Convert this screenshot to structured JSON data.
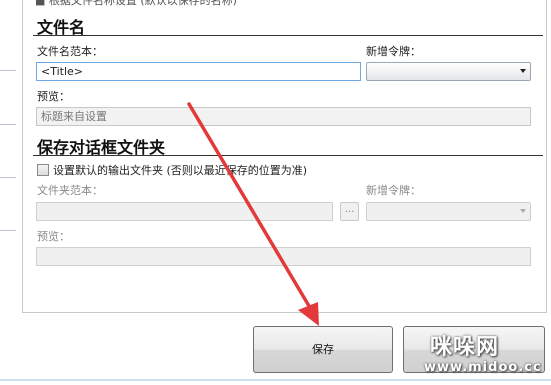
{
  "clipped_top_text": "■ 根据文件名称设置 (默认以保存的名称)",
  "filename_section": {
    "title": "文件名",
    "template_label": "文件名范本：",
    "template_value": "<Title>",
    "token_label": "新增令牌：",
    "preview_label": "预览：",
    "preview_value": "标题来自设置"
  },
  "save_dialog_section": {
    "title": "保存对话框文件夹",
    "checkbox_label": "设置默认的输出文件夹 (否则以最近保存的位置为准)",
    "folder_template_label": "文件夹范本：",
    "browse_label": "...",
    "token_label": "新增令牌：",
    "preview_label": "预览："
  },
  "buttons": {
    "save_label": "保存"
  },
  "watermark": {
    "line1": "咪哚网",
    "line2": "www.midoo.cc"
  },
  "colors": {
    "annotation_arrow": "#e23a3a",
    "focus_border": "#6ea8e6"
  }
}
